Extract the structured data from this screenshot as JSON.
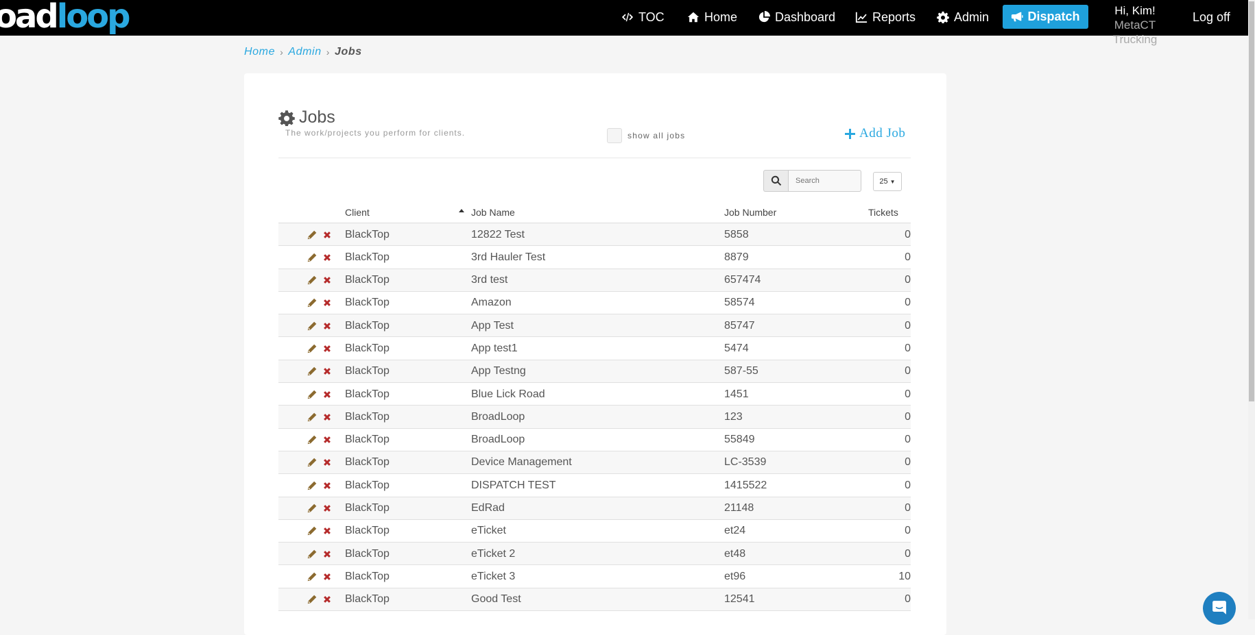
{
  "brand": {
    "part1": "oad",
    "part2": "loop"
  },
  "nav": {
    "toc": "TOC",
    "home": "Home",
    "dashboard": "Dashboard",
    "reports": "Reports",
    "admin": "Admin",
    "dispatch": "Dispatch",
    "greeting": "Hi, Kim!",
    "company": "MetaCT Trucking",
    "logoff": "Log off"
  },
  "breadcrumb": {
    "home": "Home",
    "admin": "Admin",
    "current": "Jobs"
  },
  "page": {
    "title": "Jobs",
    "subtitle": "The work/projects you perform for clients.",
    "show_all_label": "show all jobs",
    "add_job": "Add Job",
    "search_placeholder": "Search",
    "page_size": "25"
  },
  "table": {
    "headers": {
      "client": "Client",
      "job_name": "Job Name",
      "job_number": "Job Number",
      "tickets": "Tickets"
    },
    "rows": [
      {
        "client": "BlackTop",
        "job_name": "12822 Test",
        "job_number": "5858",
        "tickets": "0"
      },
      {
        "client": "BlackTop",
        "job_name": "3rd Hauler Test",
        "job_number": "8879",
        "tickets": "0"
      },
      {
        "client": "BlackTop",
        "job_name": "3rd test",
        "job_number": "657474",
        "tickets": "0"
      },
      {
        "client": "BlackTop",
        "job_name": "Amazon",
        "job_number": "58574",
        "tickets": "0"
      },
      {
        "client": "BlackTop",
        "job_name": "App Test",
        "job_number": "85747",
        "tickets": "0"
      },
      {
        "client": "BlackTop",
        "job_name": "App test1",
        "job_number": "5474",
        "tickets": "0"
      },
      {
        "client": "BlackTop",
        "job_name": "App Testng",
        "job_number": "587-55",
        "tickets": "0"
      },
      {
        "client": "BlackTop",
        "job_name": "Blue Lick Road",
        "job_number": "1451",
        "tickets": "0"
      },
      {
        "client": "BlackTop",
        "job_name": "BroadLoop",
        "job_number": "123",
        "tickets": "0"
      },
      {
        "client": "BlackTop",
        "job_name": "BroadLoop",
        "job_number": "55849",
        "tickets": "0"
      },
      {
        "client": "BlackTop",
        "job_name": "Device Management",
        "job_number": "LC-3539",
        "tickets": "0"
      },
      {
        "client": "BlackTop",
        "job_name": "DISPATCH TEST",
        "job_number": "1415522",
        "tickets": "0"
      },
      {
        "client": "BlackTop",
        "job_name": "EdRad",
        "job_number": "21148",
        "tickets": "0"
      },
      {
        "client": "BlackTop",
        "job_name": "eTicket",
        "job_number": "et24",
        "tickets": "0"
      },
      {
        "client": "BlackTop",
        "job_name": "eTicket 2",
        "job_number": "et48",
        "tickets": "0"
      },
      {
        "client": "BlackTop",
        "job_name": "eTicket 3",
        "job_number": "et96",
        "tickets": "10"
      },
      {
        "client": "BlackTop",
        "job_name": "Good Test",
        "job_number": "12541",
        "tickets": "0"
      }
    ]
  }
}
